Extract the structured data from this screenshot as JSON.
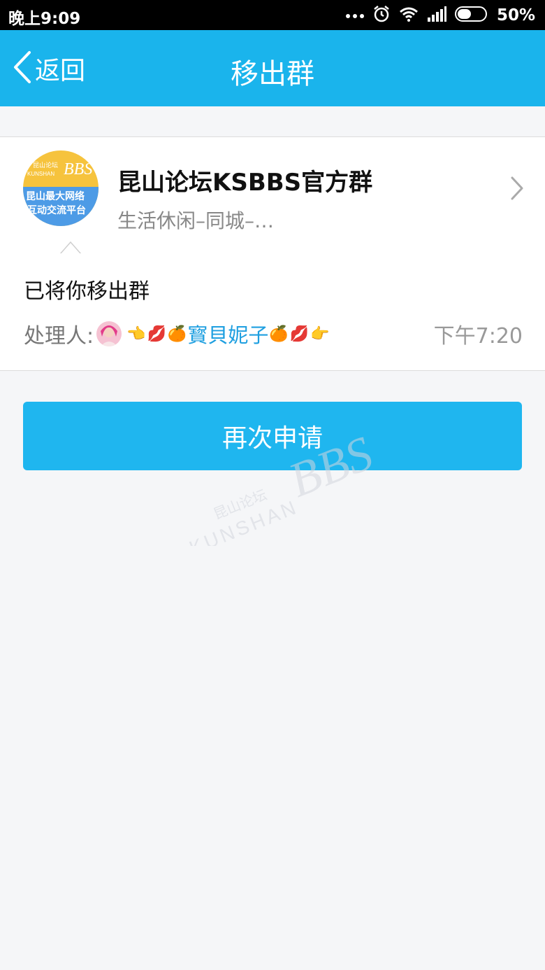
{
  "status_bar": {
    "time": "晚上9:09",
    "battery_percent": "50%",
    "battery_level": 0.5,
    "icons": [
      "more-dots-icon",
      "alarm-icon",
      "wifi-icon",
      "signal-icon",
      "battery-icon"
    ]
  },
  "header": {
    "back_label": "返回",
    "title": "移出群"
  },
  "group": {
    "name": "昆山论坛KSBBS官方群",
    "category": "生活休闲–同城–…",
    "avatar_text": {
      "brand_small": "昆山论坛",
      "brand_en": "KUNSHAN",
      "brand_big": "BBS",
      "line1": "昆山最大网络",
      "line2": "互动交流平台"
    }
  },
  "notice": {
    "message": "已将你移出群",
    "handler_label": "处理人:",
    "handler_name": "寳貝妮子",
    "handler_emojis_left": [
      "👈",
      "💋",
      "🍊"
    ],
    "handler_emojis_right": [
      "🍊",
      "💋",
      "👉"
    ],
    "time": "下午7:20"
  },
  "actions": {
    "reapply_label": "再次申请"
  },
  "watermark": {
    "cn": "昆山论坛",
    "en": "KUNSHAN",
    "big": "BBS"
  },
  "colors": {
    "accent": "#1ab4ec",
    "button": "#1fb6ef",
    "link": "#1e9fe0",
    "background": "#f5f6f8"
  }
}
